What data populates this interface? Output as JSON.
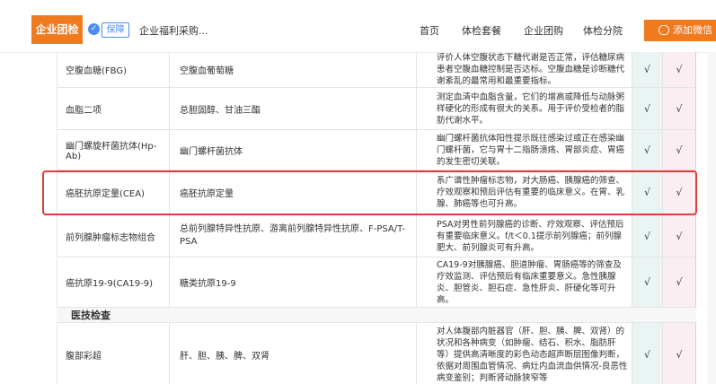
{
  "header": {
    "brand": "企业团检",
    "badge": "保障",
    "welfare": "企业福利采购...",
    "nav": [
      "首页",
      "体检套餐",
      "企业团购",
      "体检分院"
    ],
    "wechat_button": "添加微信"
  },
  "table": {
    "check_mark": "√",
    "rows": [
      {
        "name": "空腹血糖(FBG)",
        "content": "空腹血葡萄糖",
        "desc": "评价人体空腹状态下糖代谢是否正常，评估糖尿病患者空腹血糖控制是否达标。空腹血糖是诊断糖代谢紊乱的最常用和最重要指标。"
      },
      {
        "name": "血脂二项",
        "content": "总胆固醇、甘油三酯",
        "desc": "测定血清中血脂含量，它们的增高或降低与动脉粥样硬化的形成有很大的关系。用于评价受检者的脂肪代谢水平。"
      },
      {
        "name": "幽门螺旋杆菌抗体(Hp-Ab)",
        "content": "幽门螺杆菌抗体",
        "desc": "幽门螺杆菌抗体阳性提示既往感染过或正在感染幽门螺杆菌，它与胃十二指肠溃疡、胃部炎症、胃癌的发生密切关联。"
      },
      {
        "name": "癌胚抗原定量(CEA)",
        "content": "癌胚抗原定量",
        "desc": "系广谱性肿瘤标志物，对大肠癌、胰腺癌的筛查、疗效观察和预后评估有重要的临床意义。在胃、乳腺、肺癌等也可升高。"
      },
      {
        "name": "前列腺肿瘤标志物组合",
        "content": "总前列腺特异性抗原、游离前列腺特异性抗原、F-PSA/T-PSA",
        "desc": "PSA对男性前列腺癌的诊断、疗效观察、评估预后有重要临床意义。f/t＜0.1提示前列腺癌；前列腺肥大、前列腺炎可有升高。"
      },
      {
        "name": "癌抗原19-9(CA19-9)",
        "content": "糖类抗原19-9",
        "desc": "CA19-9对胰腺癌、胆道肿瘤、胃肠癌等的筛查及疗效监测、评估预后有临床重要意义。急性胰腺炎、胆管炎、胆石症、急性肝炎、肝硬化等可升高。"
      }
    ],
    "section_title": "医技检查",
    "last_row": {
      "name": "腹部彩超",
      "content": "肝、胆、胰、脾、双肾",
      "desc": "对人体腹部内脏器官（肝、胆、胰、脾、双肾）的状况和各种病变（如肿瘤、结石、积水、脂肪肝等）提供高清晰度的彩色动态超声断层图像判断，依据对周围血管情况、病灶内血流血供情况-良恶性病变鉴别；判断肾动脉狭窄等"
    }
  }
}
